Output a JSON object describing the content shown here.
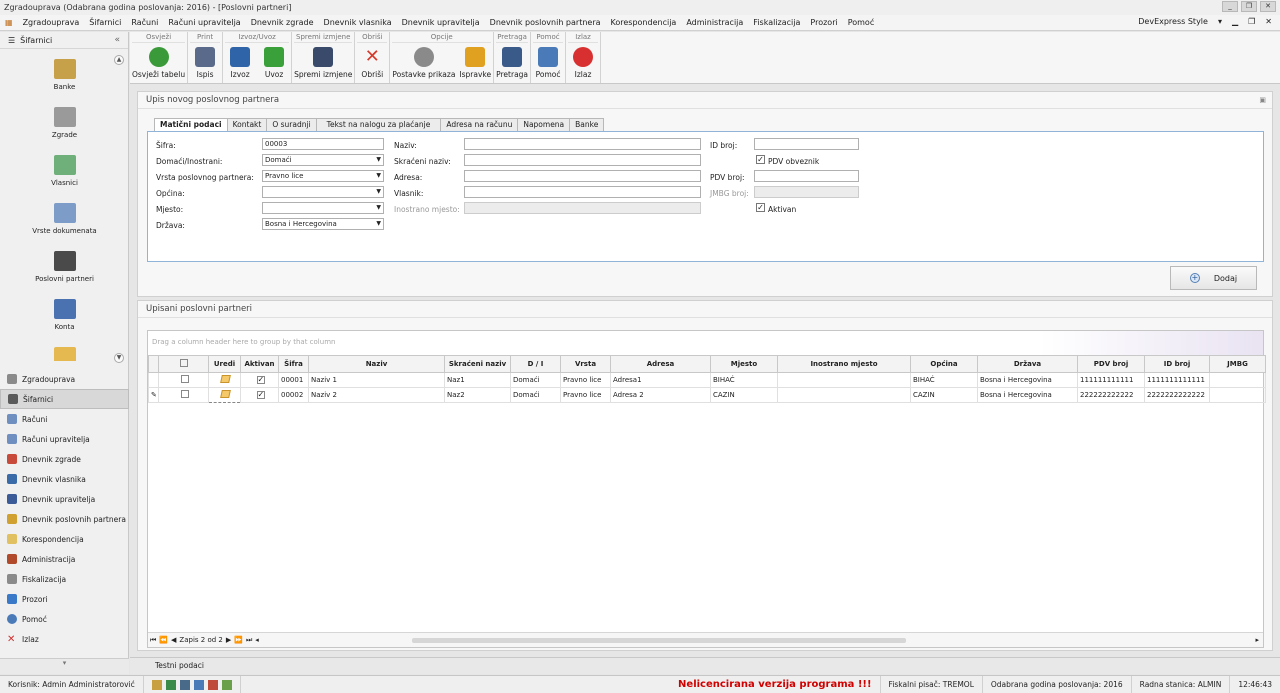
{
  "window": {
    "title": "Zgradouprava (Odabrana godina poslovanja: 2016) - [Poslovni partneri]"
  },
  "menu": {
    "items": [
      "Zgradouprava",
      "Šifarnici",
      "Računi",
      "Računi upravitelja",
      "Dnevnik zgrade",
      "Dnevnik vlasnika",
      "Dnevnik upravitelja",
      "Dnevnik poslovnih partnera",
      "Korespondencija",
      "Administracija",
      "Fiskalizacija",
      "Prozori",
      "Pomoć"
    ],
    "style_label": "DevExpress Style"
  },
  "sidebar": {
    "header": "Šifarnici",
    "big_items": [
      "Banke",
      "Zgrade",
      "Vlasnici",
      "Vrste dokumenata",
      "Poslovni partneri",
      "Konta"
    ],
    "nav_items": [
      "Zgradouprava",
      "Šifarnici",
      "Računi",
      "Računi upravitelja",
      "Dnevnik zgrade",
      "Dnevnik vlasnika",
      "Dnevnik upravitelja",
      "Dnevnik poslovnih partnera",
      "Korespondencija",
      "Administracija",
      "Fiskalizacija",
      "Prozori",
      "Pomoć",
      "Izlaz"
    ]
  },
  "ribbon": {
    "groups": [
      {
        "title": "Osvježi",
        "buttons": [
          "Osvježi tabelu"
        ]
      },
      {
        "title": "Print",
        "buttons": [
          "Ispis"
        ]
      },
      {
        "title": "Izvoz/Uvoz",
        "buttons": [
          "Izvoz",
          "Uvoz"
        ]
      },
      {
        "title": "Spremi izmjene",
        "buttons": [
          "Spremi izmjene"
        ]
      },
      {
        "title": "Obriši",
        "buttons": [
          "Obriši"
        ]
      },
      {
        "title": "Opcije",
        "buttons": [
          "Postavke prikaza",
          "Ispravke"
        ]
      },
      {
        "title": "Pretraga",
        "buttons": [
          "Pretraga"
        ]
      },
      {
        "title": "Pomoć",
        "buttons": [
          "Pomoć"
        ]
      },
      {
        "title": "Izlaz",
        "buttons": [
          "Izlaz"
        ]
      }
    ],
    "colors": [
      "#3a9a3a",
      "#5a6a8a",
      "#2f64a8",
      "#3aa03a",
      "#3a4a6a",
      "#d43a2a",
      "#8a8a8a",
      "#e0a020",
      "#3a5a8a",
      "#4a7ab8",
      "#d83030"
    ]
  },
  "form": {
    "panel_title": "Upis novog poslovnog partnera",
    "tabs": [
      "Matični podaci",
      "Kontakt",
      "O suradnji",
      "Tekst na nalogu za plaćanje",
      "Adresa na računu",
      "Napomena",
      "Banke"
    ],
    "labels": {
      "sifra": "Šifra:",
      "domaci": "Domaći/Inostrani:",
      "vrsta": "Vrsta poslovnog  partnera:",
      "opcina": "Općina:",
      "mjesto": "Mjesto:",
      "drzava": "Država:",
      "naziv": "Naziv:",
      "skraceni": "Skraćeni naziv:",
      "adresa": "Adresa:",
      "vlasnik": "Vlasnik:",
      "inostrano": "Inostrano mjesto:",
      "id_broj": "ID broj:",
      "pdv_obveznik": "PDV obveznik",
      "pdv_broj": "PDV broj:",
      "jmbg": "JMBG broj:",
      "aktivan": "Aktivan"
    },
    "values": {
      "sifra": "00003",
      "domaci": "Domaći",
      "vrsta": "Pravno lice",
      "opcina": "",
      "mjesto": "",
      "drzava": "Bosna i Hercegovina"
    },
    "add_button": "Dodaj"
  },
  "grid": {
    "panel_title": "Upisani poslovni partneri",
    "group_hint": "Drag a column header here to group by that column",
    "columns": [
      "Uredi",
      "Aktivan",
      "Šifra",
      "Naziv",
      "Skraćeni naziv",
      "D / I",
      "Vrsta",
      "Adresa",
      "Mjesto",
      "Inostrano mjesto",
      "Općina",
      "Država",
      "PDV broj",
      "ID broj",
      "JMBG"
    ],
    "rows": [
      {
        "sifra": "00001",
        "naziv": "Naziv 1",
        "skraceni": "Naz1",
        "di": "Domaći",
        "vrsta": "Pravno lice",
        "adresa": "Adresa1",
        "mjesto": "BIHAĆ",
        "inostrano": "",
        "opcina": "BIHAĆ",
        "drzava": "Bosna i Hercegovina",
        "pdv": "111111111111",
        "id": "1111111111111",
        "jmbg": ""
      },
      {
        "sifra": "00002",
        "naziv": "Naziv 2",
        "skraceni": "Naz2",
        "di": "Domaći",
        "vrsta": "Pravno lice",
        "adresa": "Adresa 2",
        "mjesto": "CAZIN",
        "inostrano": "",
        "opcina": "CAZIN",
        "drzava": "Bosna i Hercegovina",
        "pdv": "222222222222",
        "id": "2222222222222",
        "jmbg": ""
      }
    ],
    "record_label": "Zapis 2 od 2"
  },
  "bottom_tab": "Testni podaci",
  "status": {
    "user": "Korisnik: Admin Administratorović",
    "warning": "Nelicencirana verzija programa !!!",
    "printer": "Fiskalni pisač: TREMOL",
    "year": "Odabrana godina poslovanja: 2016",
    "station": "Radna stanica: ALMIN",
    "time": "12:46:43"
  }
}
